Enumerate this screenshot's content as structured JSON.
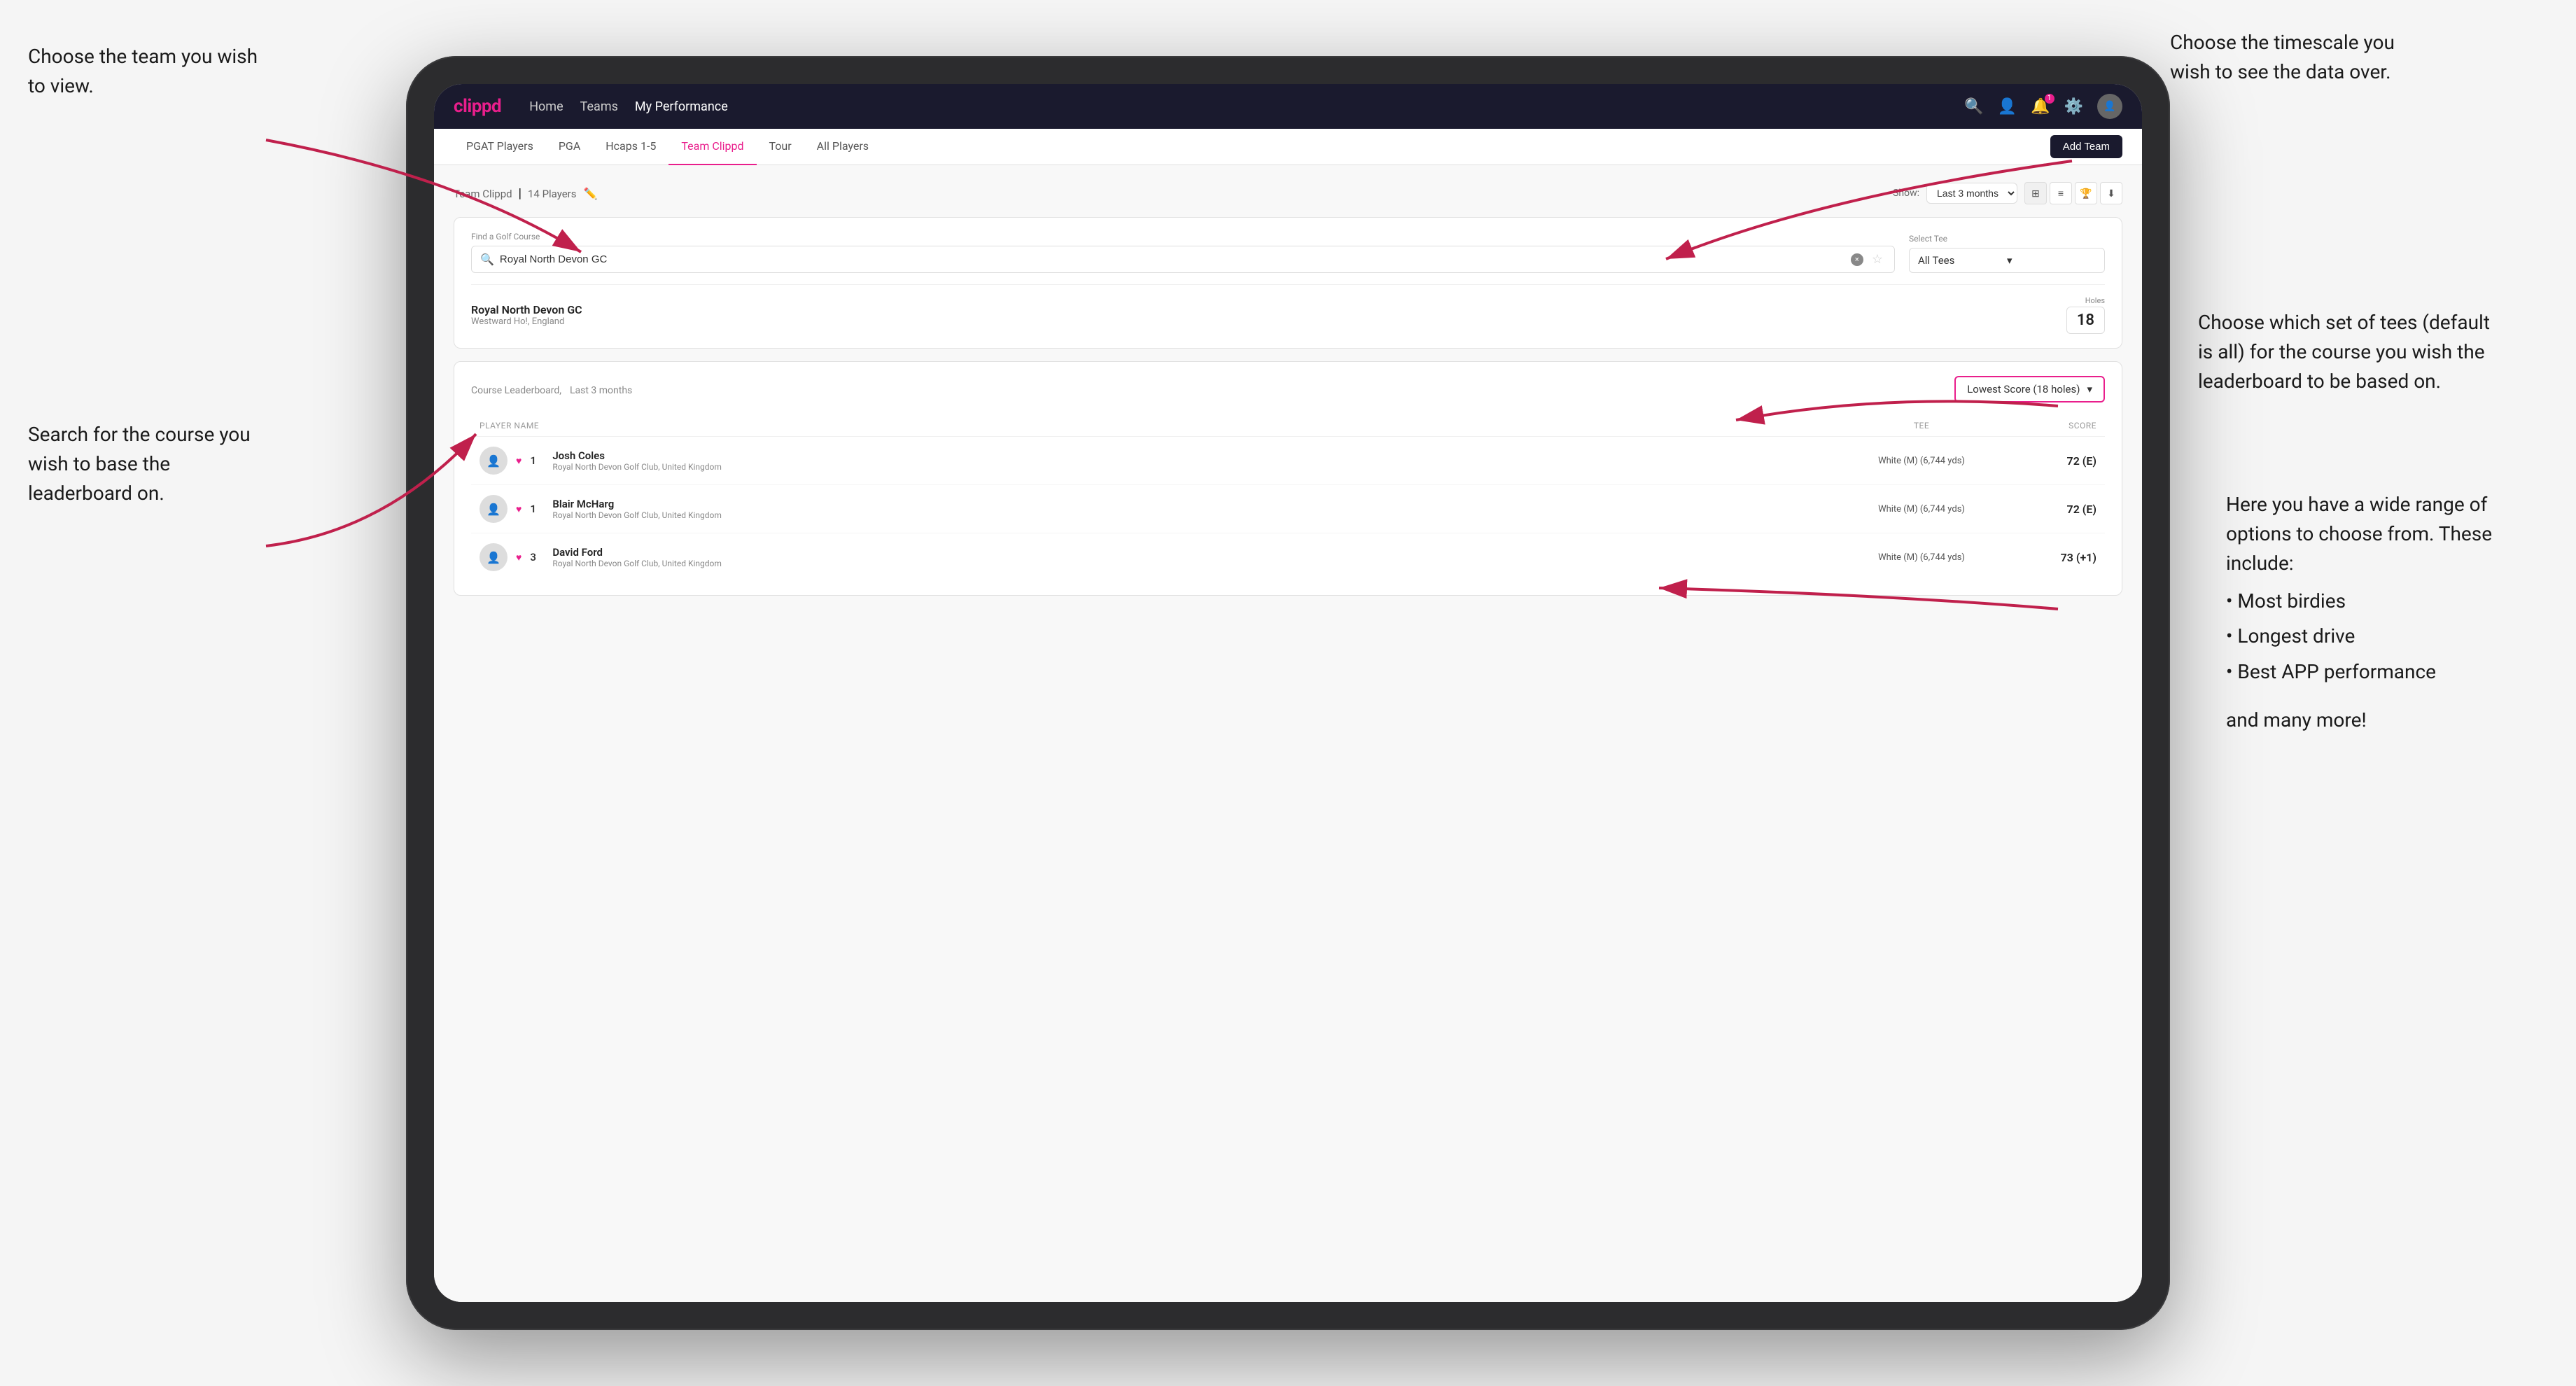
{
  "annotations": {
    "top_left": {
      "title": "Choose the team you wish to view."
    },
    "bottom_left": {
      "title": "Search for the course you wish to base the leaderboard on."
    },
    "top_right": {
      "title": "Choose the timescale you wish to see the data over."
    },
    "mid_right": {
      "title": "Choose which set of tees (default is all) for the course you wish the leaderboard to be based on."
    },
    "bottom_right": {
      "title": "Here you have a wide range of options to choose from. These include:",
      "bullets": [
        "Most birdies",
        "Longest drive",
        "Best APP performance"
      ],
      "footer": "and many more!"
    }
  },
  "nav": {
    "logo": "clippd",
    "links": [
      "Home",
      "Teams",
      "My Performance"
    ],
    "active_link": "My Performance"
  },
  "sub_nav": {
    "items": [
      "PGAT Players",
      "PGA",
      "Hcaps 1-5",
      "Team Clippd",
      "Tour",
      "All Players"
    ],
    "active_item": "Team Clippd",
    "add_team_label": "Add Team"
  },
  "team_header": {
    "name": "Team Clippd",
    "player_count": "14 Players",
    "show_label": "Show:",
    "show_value": "Last 3 months"
  },
  "course_search": {
    "find_label": "Find a Golf Course",
    "input_value": "Royal North Devon GC",
    "select_tee_label": "Select Tee",
    "tee_value": "All Tees"
  },
  "course_result": {
    "name": "Royal North Devon GC",
    "location": "Westward Ho!, England",
    "holes_label": "Holes",
    "holes": "18"
  },
  "leaderboard": {
    "title": "Course Leaderboard,",
    "subtitle": "Last 3 months",
    "score_type": "Lowest Score (18 holes)",
    "col_player": "PLAYER NAME",
    "col_tee": "TEE",
    "col_score": "SCORE",
    "players": [
      {
        "rank": "1",
        "name": "Josh Coles",
        "club": "Royal North Devon Golf Club, United Kingdom",
        "tee": "White (M) (6,744 yds)",
        "score": "72 (E)"
      },
      {
        "rank": "1",
        "name": "Blair McHarg",
        "club": "Royal North Devon Golf Club, United Kingdom",
        "tee": "White (M) (6,744 yds)",
        "score": "72 (E)"
      },
      {
        "rank": "3",
        "name": "David Ford",
        "club": "Royal North Devon Golf Club, United Kingdom",
        "tee": "White (M) (6,744 yds)",
        "score": "73 (+1)"
      }
    ]
  }
}
